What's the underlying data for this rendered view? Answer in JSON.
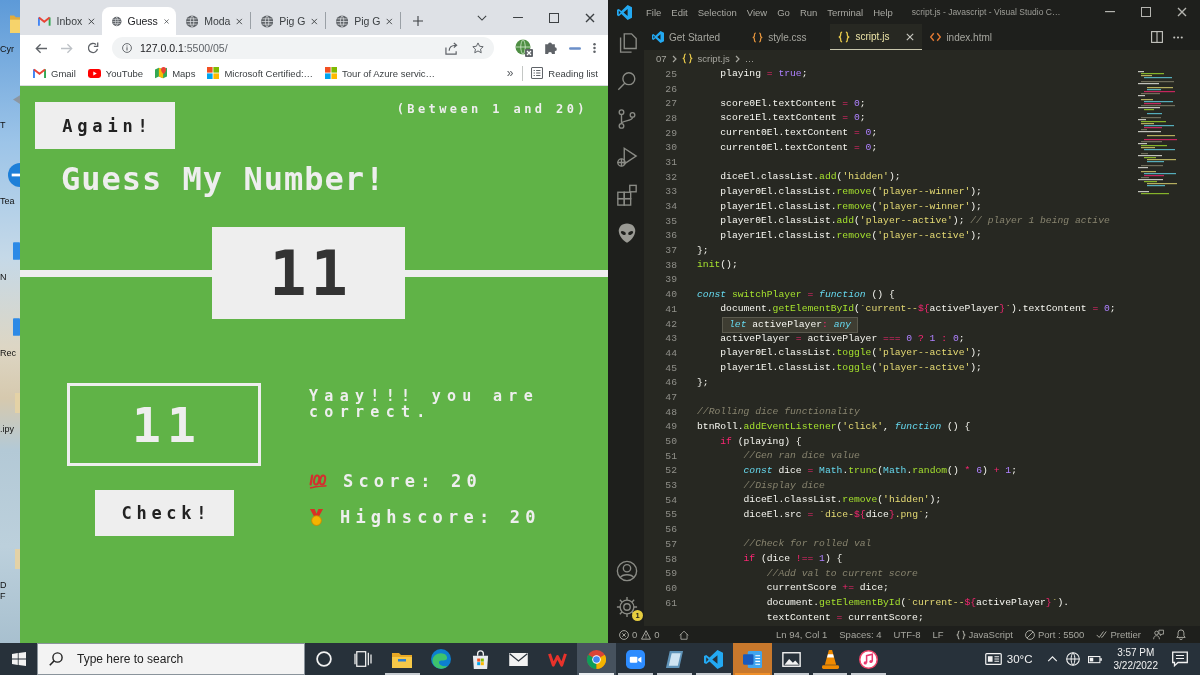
{
  "desktop": {
    "icons": [
      {
        "kind": "folder",
        "label": "Cyr"
      },
      {
        "kind": "arrow",
        "label": "T"
      },
      {
        "kind": "circle",
        "label": "Tea"
      },
      {
        "kind": "tile",
        "label": "N"
      },
      {
        "kind": "tile",
        "label": "Rec"
      },
      {
        "kind": "file",
        "label": ".ipy"
      },
      {
        "kind": "file",
        "label": "D"
      },
      {
        "label": "F"
      }
    ]
  },
  "browser": {
    "tabs": [
      {
        "kind": "gmail",
        "title": "Inbox",
        "selected": false
      },
      {
        "kind": "globe",
        "title": "Guess",
        "selected": true
      },
      {
        "kind": "globe",
        "title": "Moda",
        "selected": false
      },
      {
        "kind": "globe",
        "title": "Pig G",
        "selected": false
      },
      {
        "kind": "globe",
        "title": "Pig G",
        "selected": false
      }
    ],
    "forward": {
      "disabled": true
    },
    "address": {
      "host": "127.0.0.1",
      "path": ":5500/05/"
    },
    "bookmarks": [
      {
        "kind": "gmail",
        "label": "Gmail"
      },
      {
        "kind": "youtube",
        "label": "YouTube"
      },
      {
        "kind": "maps",
        "label": "Maps"
      },
      {
        "kind": "microsoft",
        "label": "Microsoft Certified:…"
      },
      {
        "kind": "microsoft",
        "label": "Tour of Azure servic…"
      }
    ],
    "more_bookmarks": "»",
    "reading_list": "Reading list"
  },
  "game": {
    "again_button": "Again!",
    "hint": "(Between 1 and 20)",
    "title": "Guess My Number!",
    "secret_number": "11",
    "guess": "11",
    "check_button": "Check!",
    "message": "Yaay!!! you are correct.",
    "score": "Score: 20",
    "highscore": "Highscore: 20"
  },
  "editor": {
    "menu": [
      "File",
      "Edit",
      "Selection",
      "View",
      "Go",
      "Run",
      "Terminal",
      "Help"
    ],
    "title": "script.js - Javascript - Visual Studio C…",
    "tabs": [
      {
        "kind": "welcome",
        "title": "Get Started",
        "selected": false
      },
      {
        "kind": "css",
        "title": "style.css",
        "selected": false
      },
      {
        "kind": "js",
        "title": "script.js",
        "selected": true
      },
      {
        "kind": "html",
        "title": "index.html",
        "selected": false
      }
    ],
    "breadcrumb": {
      "folder": "07",
      "file": "script.js",
      "symbol": "…"
    },
    "lines": [
      {
        "number": "25",
        "tokens": [
          {
            "kind": "plain",
            "text": "    playing "
          },
          {
            "kind": "op",
            "text": "="
          },
          {
            "kind": "const",
            "text": " true"
          },
          {
            "kind": "plain",
            "text": ";"
          }
        ]
      },
      {
        "number": "26"
      },
      {
        "number": "27",
        "tokens": [
          {
            "kind": "plain",
            "text": "    score0El.textContent "
          },
          {
            "kind": "op",
            "text": "="
          },
          {
            "kind": "const",
            "text": " 0"
          },
          {
            "kind": "plain",
            "text": ";"
          }
        ]
      },
      {
        "number": "28",
        "tokens": [
          {
            "kind": "plain",
            "text": "    score1El.textContent "
          },
          {
            "kind": "op",
            "text": "="
          },
          {
            "kind": "const",
            "text": " 0"
          },
          {
            "kind": "plain",
            "text": ";"
          }
        ]
      },
      {
        "number": "29",
        "tokens": [
          {
            "kind": "plain",
            "text": "    current0El.textContent "
          },
          {
            "kind": "op",
            "text": "="
          },
          {
            "kind": "const",
            "text": " 0"
          },
          {
            "kind": "plain",
            "text": ";"
          }
        ]
      },
      {
        "number": "30",
        "tokens": [
          {
            "kind": "plain",
            "text": "    current0El.textContent "
          },
          {
            "kind": "op",
            "text": "="
          },
          {
            "kind": "const",
            "text": " 0"
          },
          {
            "kind": "plain",
            "text": ";"
          }
        ]
      },
      {
        "number": "31"
      },
      {
        "number": "32",
        "tokens": [
          {
            "kind": "plain",
            "text": "    diceEl.classList."
          },
          {
            "kind": "method",
            "text": "add"
          },
          {
            "kind": "plain",
            "text": "("
          },
          {
            "kind": "string",
            "text": "'hidden'"
          },
          {
            "kind": "plain",
            "text": ");"
          }
        ]
      },
      {
        "number": "33",
        "tokens": [
          {
            "kind": "plain",
            "text": "    player0El.classList."
          },
          {
            "kind": "method",
            "text": "remove"
          },
          {
            "kind": "plain",
            "text": "("
          },
          {
            "kind": "string",
            "text": "'player--winner'"
          },
          {
            "kind": "plain",
            "text": ");"
          }
        ]
      },
      {
        "number": "34",
        "tokens": [
          {
            "kind": "plain",
            "text": "    player1El.classList."
          },
          {
            "kind": "method",
            "text": "remove"
          },
          {
            "kind": "plain",
            "text": "("
          },
          {
            "kind": "string",
            "text": "'player--winner'"
          },
          {
            "kind": "plain",
            "text": ");"
          }
        ]
      },
      {
        "number": "35",
        "tokens": [
          {
            "kind": "plain",
            "text": "    player0El.classList."
          },
          {
            "kind": "method",
            "text": "add"
          },
          {
            "kind": "plain",
            "text": "("
          },
          {
            "kind": "string",
            "text": "'player--active'"
          },
          {
            "kind": "plain",
            "text": "); "
          },
          {
            "kind": "comment",
            "text": "// player 1 being active"
          }
        ]
      },
      {
        "number": "36",
        "tokens": [
          {
            "kind": "plain",
            "text": "    player1El.classList."
          },
          {
            "kind": "method",
            "text": "remove"
          },
          {
            "kind": "plain",
            "text": "("
          },
          {
            "kind": "string",
            "text": "'player--active'"
          },
          {
            "kind": "plain",
            "text": ");"
          }
        ]
      },
      {
        "number": "37",
        "tokens": [
          {
            "kind": "plain",
            "text": "};"
          }
        ]
      },
      {
        "number": "38",
        "tokens": [
          {
            "kind": "method",
            "text": "init"
          },
          {
            "kind": "plain",
            "text": "();"
          }
        ]
      },
      {
        "number": "39"
      },
      {
        "number": "40",
        "tokens": [
          {
            "kind": "storage",
            "text": "const"
          },
          {
            "kind": "method",
            "text": " switchPlayer"
          },
          {
            "kind": "op",
            "text": " ="
          },
          {
            "kind": "storage",
            "text": " function"
          },
          {
            "kind": "plain",
            "text": " () {"
          }
        ]
      },
      {
        "number": "41",
        "tokens": [
          {
            "kind": "plain",
            "text": "    document."
          },
          {
            "kind": "method",
            "text": "getElementById"
          },
          {
            "kind": "plain",
            "text": "("
          },
          {
            "kind": "string",
            "text": "`current--"
          },
          {
            "kind": "interp",
            "text": "${"
          },
          {
            "kind": "plain",
            "text": "activePlayer"
          },
          {
            "kind": "interp",
            "text": "}"
          },
          {
            "kind": "string",
            "text": "`"
          },
          {
            "kind": "plain",
            "text": ").textContent "
          },
          {
            "kind": "op",
            "text": "="
          },
          {
            "kind": "const",
            "text": " 0"
          },
          {
            "kind": "plain",
            "text": ";"
          }
        ]
      },
      {
        "number": "42",
        "hover": {
          "tokens": [
            {
              "kind": "storage",
              "text": "let"
            },
            {
              "kind": "plain",
              "text": " activePlayer"
            },
            {
              "kind": "op",
              "text": ":"
            },
            {
              "kind": "storage",
              "text": " any"
            }
          ]
        }
      },
      {
        "number": "43",
        "tokens": [
          {
            "kind": "plain",
            "text": "    activePlayer "
          },
          {
            "kind": "op",
            "text": "="
          },
          {
            "kind": "plain",
            "text": " activePlayer "
          },
          {
            "kind": "op",
            "text": "==="
          },
          {
            "kind": "const",
            "text": " 0"
          },
          {
            "kind": "op",
            "text": " ?"
          },
          {
            "kind": "const",
            "text": " 1"
          },
          {
            "kind": "op",
            "text": " :"
          },
          {
            "kind": "const",
            "text": " 0"
          },
          {
            "kind": "plain",
            "text": ";"
          }
        ]
      },
      {
        "number": "44",
        "tokens": [
          {
            "kind": "plain",
            "text": "    player0El.classList."
          },
          {
            "kind": "method",
            "text": "toggle"
          },
          {
            "kind": "plain",
            "text": "("
          },
          {
            "kind": "string",
            "text": "'player--active'"
          },
          {
            "kind": "plain",
            "text": ");"
          }
        ]
      },
      {
        "number": "45",
        "tokens": [
          {
            "kind": "plain",
            "text": "    player1El.classList."
          },
          {
            "kind": "method",
            "text": "toggle"
          },
          {
            "kind": "plain",
            "text": "("
          },
          {
            "kind": "string",
            "text": "'player--active'"
          },
          {
            "kind": "plain",
            "text": ");"
          }
        ]
      },
      {
        "number": "46",
        "tokens": [
          {
            "kind": "plain",
            "text": "};"
          }
        ]
      },
      {
        "number": "47"
      },
      {
        "number": "48",
        "tokens": [
          {
            "kind": "comment",
            "text": "//Rolling dice functionality"
          }
        ]
      },
      {
        "number": "49",
        "tokens": [
          {
            "kind": "plain",
            "text": "btnRoll."
          },
          {
            "kind": "method",
            "text": "addEventListener"
          },
          {
            "kind": "plain",
            "text": "("
          },
          {
            "kind": "string",
            "text": "'click'"
          },
          {
            "kind": "plain",
            "text": ", "
          },
          {
            "kind": "storage",
            "text": "function"
          },
          {
            "kind": "plain",
            "text": " () {"
          }
        ]
      },
      {
        "number": "50",
        "tokens": [
          {
            "kind": "keyword",
            "text": "    if"
          },
          {
            "kind": "plain",
            "text": " (playing) {"
          }
        ]
      },
      {
        "number": "51",
        "tokens": [
          {
            "kind": "comment",
            "text": "        //Gen ran dice value"
          }
        ]
      },
      {
        "number": "52",
        "tokens": [
          {
            "kind": "storage",
            "text": "        const"
          },
          {
            "kind": "plain",
            "text": " dice "
          },
          {
            "kind": "op",
            "text": "="
          },
          {
            "kind": "support",
            "text": " Math"
          },
          {
            "kind": "plain",
            "text": "."
          },
          {
            "kind": "method",
            "text": "trunc"
          },
          {
            "kind": "plain",
            "text": "("
          },
          {
            "kind": "support",
            "text": "Math"
          },
          {
            "kind": "plain",
            "text": "."
          },
          {
            "kind": "method",
            "text": "random"
          },
          {
            "kind": "plain",
            "text": "() "
          },
          {
            "kind": "op",
            "text": "*"
          },
          {
            "kind": "const",
            "text": " 6"
          },
          {
            "kind": "plain",
            "text": ") "
          },
          {
            "kind": "op",
            "text": "+"
          },
          {
            "kind": "const",
            "text": " 1"
          },
          {
            "kind": "plain",
            "text": ";"
          }
        ]
      },
      {
        "number": "53",
        "tokens": [
          {
            "kind": "comment",
            "text": "        //Display dice"
          }
        ]
      },
      {
        "number": "54",
        "tokens": [
          {
            "kind": "plain",
            "text": "        diceEl.classList."
          },
          {
            "kind": "method",
            "text": "remove"
          },
          {
            "kind": "plain",
            "text": "("
          },
          {
            "kind": "string",
            "text": "'hidden'"
          },
          {
            "kind": "plain",
            "text": ");"
          }
        ]
      },
      {
        "number": "55",
        "tokens": [
          {
            "kind": "plain",
            "text": "        diceEl.src "
          },
          {
            "kind": "op",
            "text": "="
          },
          {
            "kind": "string",
            "text": " `dice-"
          },
          {
            "kind": "interp",
            "text": "${"
          },
          {
            "kind": "plain",
            "text": "dice"
          },
          {
            "kind": "interp",
            "text": "}"
          },
          {
            "kind": "string",
            "text": ".png`"
          },
          {
            "kind": "plain",
            "text": ";"
          }
        ]
      },
      {
        "number": "56"
      },
      {
        "number": "57",
        "tokens": [
          {
            "kind": "comment",
            "text": "        //Check for rolled val"
          }
        ]
      },
      {
        "number": "58",
        "tokens": [
          {
            "kind": "keyword",
            "text": "        if"
          },
          {
            "kind": "plain",
            "text": " (dice "
          },
          {
            "kind": "op",
            "text": "!=="
          },
          {
            "kind": "const",
            "text": " 1"
          },
          {
            "kind": "plain",
            "text": ") {"
          }
        ]
      },
      {
        "number": "59",
        "tokens": [
          {
            "kind": "comment",
            "text": "            //Add val to current score"
          }
        ]
      },
      {
        "number": "60",
        "tokens": [
          {
            "kind": "plain",
            "text": "            currentScore "
          },
          {
            "kind": "op",
            "text": "+="
          },
          {
            "kind": "plain",
            "text": " dice;"
          }
        ]
      },
      {
        "number": "61",
        "tokens": [
          {
            "kind": "plain",
            "text": "            document."
          },
          {
            "kind": "method",
            "text": "getElementById"
          },
          {
            "kind": "plain",
            "text": "("
          },
          {
            "kind": "string",
            "text": "`current--"
          },
          {
            "kind": "interp",
            "text": "${"
          },
          {
            "kind": "plain",
            "text": "activePlayer"
          },
          {
            "kind": "interp",
            "text": "}"
          },
          {
            "kind": "string",
            "text": "`"
          },
          {
            "kind": "plain",
            "text": ")."
          }
        ]
      },
      {
        "tokens": [
          {
            "kind": "plain",
            "text": "            textContent "
          },
          {
            "kind": "op",
            "text": "="
          },
          {
            "kind": "plain",
            "text": " currentScore;"
          }
        ]
      }
    ],
    "settings_badge": "1",
    "status": {
      "errors": "0",
      "warnings": "0",
      "cursor": "Ln 94, Col 1",
      "indent": "Spaces: 4",
      "encoding": "UTF-8",
      "eol": "LF",
      "language": "JavaScript",
      "port": "Port : 5500",
      "formatter": "Prettier"
    }
  },
  "taskbar": {
    "search": {
      "placeholder": "Type here to search"
    },
    "apps": [
      {
        "kind": "cortana",
        "selected": false,
        "attention": false,
        "running": false
      },
      {
        "kind": "taskview",
        "selected": false,
        "attention": false,
        "running": false
      },
      {
        "kind": "explorer",
        "selected": false,
        "attention": false,
        "running": true
      },
      {
        "kind": "edge",
        "selected": false,
        "attention": false,
        "running": false
      },
      {
        "kind": "store",
        "selected": false,
        "attention": false,
        "running": false
      },
      {
        "kind": "mail",
        "selected": false,
        "attention": false,
        "running": false
      },
      {
        "kind": "wps",
        "selected": false,
        "attention": false,
        "running": false
      },
      {
        "kind": "chrome",
        "selected": true,
        "attention": false,
        "running": true
      },
      {
        "kind": "zoom",
        "selected": false,
        "attention": false,
        "running": true
      },
      {
        "kind": "notebook",
        "selected": false,
        "attention": false,
        "running": true
      },
      {
        "kind": "vscode",
        "selected": false,
        "attention": false,
        "running": true
      },
      {
        "kind": "word",
        "selected": false,
        "attention": true,
        "running": true
      },
      {
        "kind": "photos",
        "selected": false,
        "attention": false,
        "running": true
      },
      {
        "kind": "vlc",
        "selected": false,
        "attention": false,
        "running": true
      },
      {
        "kind": "itunes",
        "selected": false,
        "attention": false,
        "running": true
      }
    ],
    "temperature": "30°C",
    "time": "3:57 PM",
    "date": "3/22/2022"
  }
}
